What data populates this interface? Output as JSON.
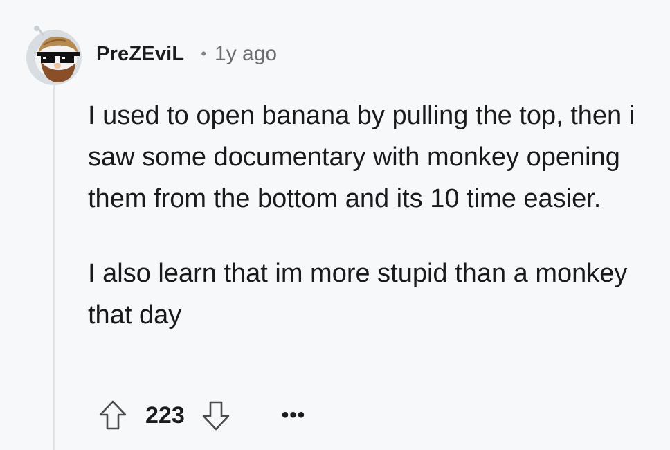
{
  "comment": {
    "username": "PreZEviL",
    "separator": "•",
    "time": "1y ago",
    "paragraphs": [
      "I used to open banana by pulling the top, then i saw some documentary with monkey opening them from the bottom and its 10 time easier.",
      "I also learn that im more stupid than a monkey that day"
    ],
    "score": "223",
    "more_label": "•••"
  },
  "icons": {
    "avatar": "snoo-avatar-with-pixel-sunglasses",
    "upvote": "upvote-arrow-icon",
    "downvote": "downvote-arrow-icon",
    "more": "more-options-icon"
  },
  "colors": {
    "background": "#f7f8fa",
    "thread_line": "#dde3e7",
    "muted_text": "#6b6f72"
  }
}
